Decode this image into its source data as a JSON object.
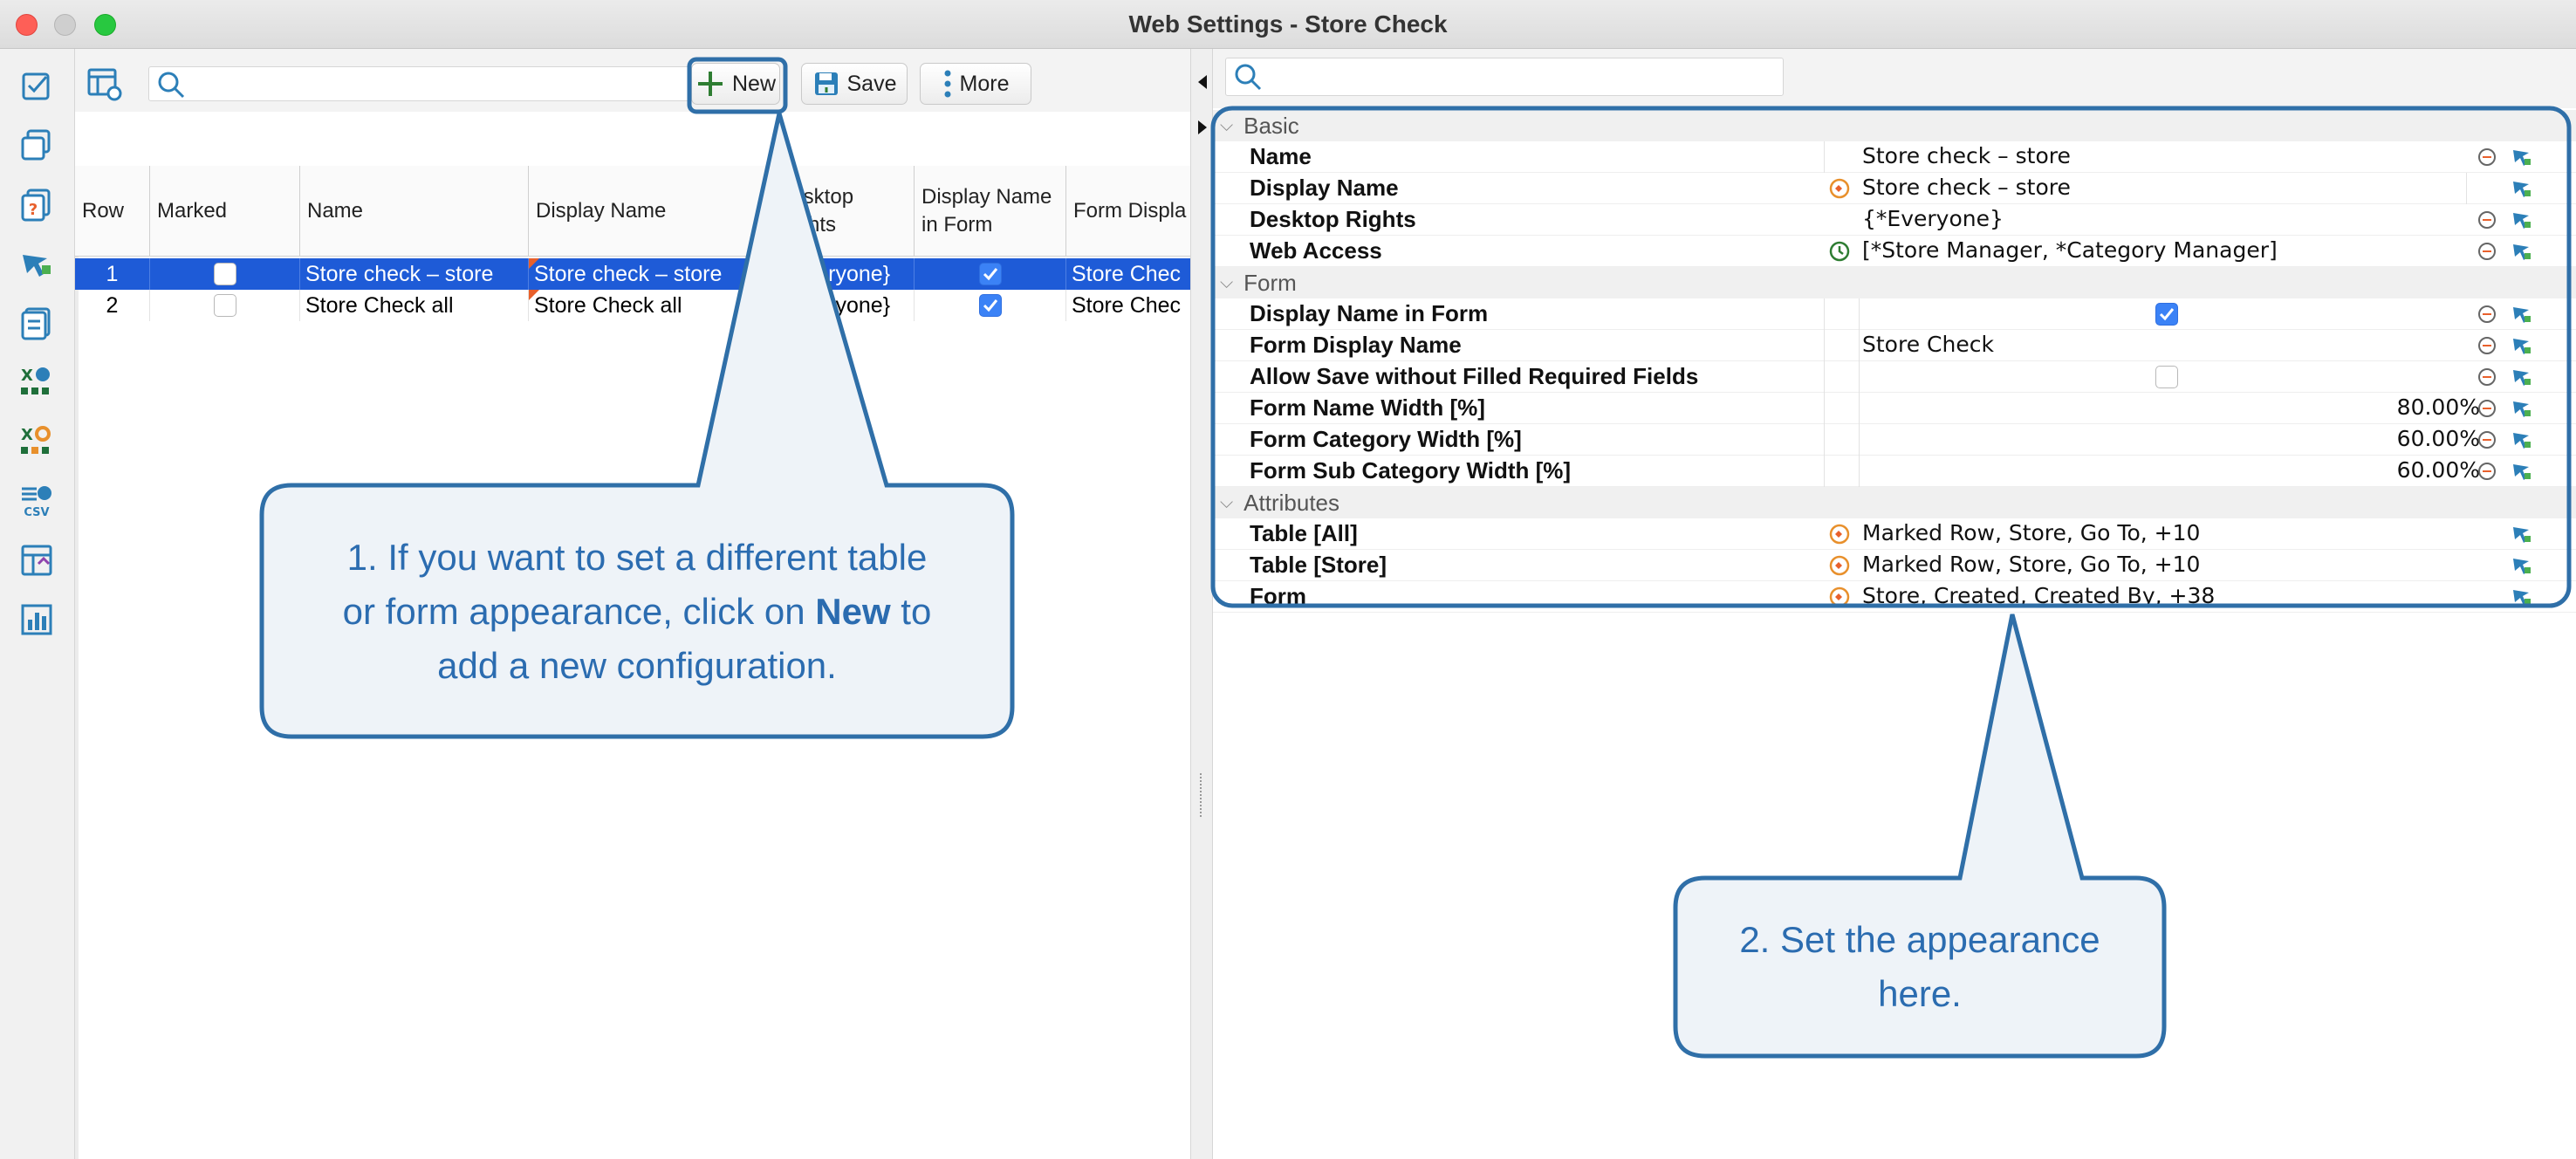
{
  "window": {
    "title": "Web Settings - Store Check"
  },
  "left_toolbar": {
    "search_placeholder": "",
    "new_label": "New",
    "save_label": "Save",
    "more_label": "More"
  },
  "grid": {
    "headers": [
      "Row",
      "Marked",
      "Name",
      "Display Name",
      "Desktop Rights",
      "Display Name in Form",
      "Form Displa"
    ],
    "rows": [
      {
        "row": "1",
        "marked": false,
        "name": "Store check – store",
        "display_name": "Store check – store",
        "desktop_rights": "{*Everyone}",
        "display_in_form": true,
        "form_display": "Store Chec",
        "selected": true
      },
      {
        "row": "2",
        "marked": false,
        "name": "Store Check all",
        "display_name": "Store Check all",
        "desktop_rights": "{*Everyone}",
        "display_in_form": true,
        "form_display": "Store Chec",
        "selected": false
      }
    ]
  },
  "properties": {
    "sections": {
      "basic": "Basic",
      "form": "Form",
      "attributes": "Attributes"
    },
    "rows": {
      "name": {
        "label": "Name",
        "value": "Store check – store"
      },
      "display_name": {
        "label": "Display Name",
        "value": "Store check – store"
      },
      "desktop_rights": {
        "label": "Desktop Rights",
        "value": "{*Everyone}"
      },
      "web_access": {
        "label": "Web Access",
        "value": "[*Store Manager, *Category Manager]"
      },
      "display_in_form": {
        "label": "Display Name in Form",
        "checked": true
      },
      "form_display_name": {
        "label": "Form Display Name",
        "value": "Store Check"
      },
      "allow_save": {
        "label": "Allow Save without Filled Required Fields",
        "checked": false
      },
      "form_name_width": {
        "label": "Form Name Width [%]",
        "value": "80.00%"
      },
      "form_category_width": {
        "label": "Form Category Width [%]",
        "value": "60.00%"
      },
      "form_sub_category_width": {
        "label": "Form Sub Category Width [%]",
        "value": "60.00%"
      },
      "table_all": {
        "label": "Table [All]",
        "value": "Marked Row, Store, Go To, +10"
      },
      "table_store": {
        "label": "Table [Store]",
        "value": "Marked Row, Store, Go To, +10"
      },
      "form": {
        "label": "Form",
        "value": "Store, Created, Created By, +38"
      }
    }
  },
  "callouts": {
    "one": {
      "line1": "1. If you want to set a different table",
      "line2_pre": "or form appearance, click on ",
      "line2_bold": "New",
      "line2_post": " to",
      "line3": "add a new configuration."
    },
    "two": {
      "line1": "2. Set the appearance",
      "line2": "here."
    }
  },
  "colors": {
    "accent": "#1e5bd7",
    "callout_border": "#2f6fa8",
    "callout_fill": "#eef3f8",
    "callout_text": "#2b6cb0"
  }
}
